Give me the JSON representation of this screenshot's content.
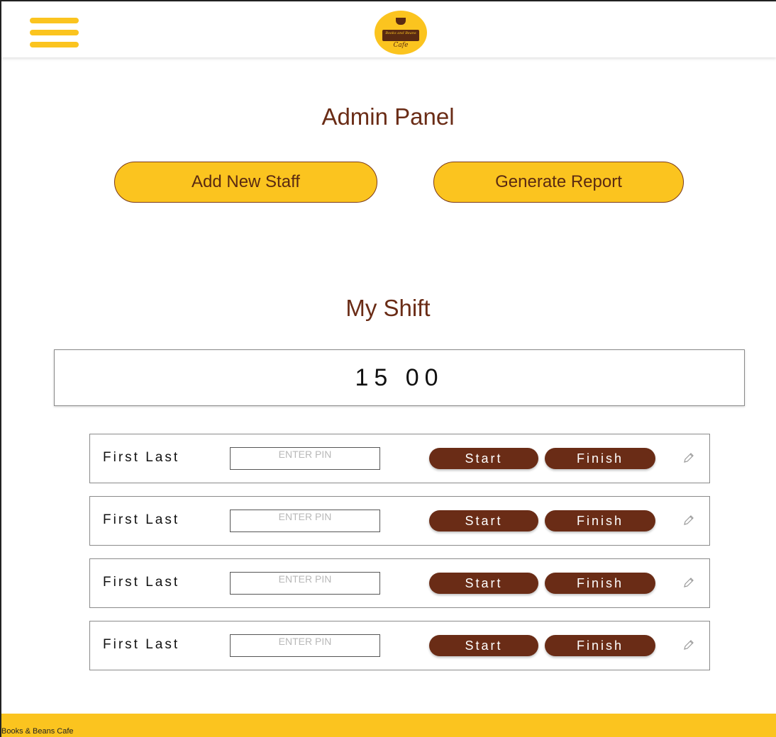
{
  "header": {
    "menu_icon": "hamburger-menu-icon",
    "logo": {
      "banner_text": "Books and Beans",
      "cafe_text": "Cafe"
    }
  },
  "admin": {
    "title": "Admin Panel",
    "add_staff_label": "Add New Staff",
    "generate_report_label": "Generate Report"
  },
  "shift": {
    "title": "My Shift",
    "timer": "15 00"
  },
  "staff": [
    {
      "name": "First Last",
      "pin_placeholder": "ENTER PIN",
      "start_label": "Start",
      "finish_label": "Finish",
      "edit_icon": "pencil-icon"
    },
    {
      "name": "First Last",
      "pin_placeholder": "ENTER PIN",
      "start_label": "Start",
      "finish_label": "Finish",
      "edit_icon": "pencil-icon"
    },
    {
      "name": "First Last",
      "pin_placeholder": "ENTER PIN",
      "start_label": "Start",
      "finish_label": "Finish",
      "edit_icon": "pencil-icon"
    },
    {
      "name": "First Last",
      "pin_placeholder": "ENTER PIN",
      "start_label": "Start",
      "finish_label": "Finish",
      "edit_icon": "pencil-icon"
    }
  ],
  "footer": {
    "text": "Books & Beans Cafe"
  },
  "colors": {
    "accent_yellow": "#fbc41f",
    "brand_brown": "#6a2c16"
  }
}
